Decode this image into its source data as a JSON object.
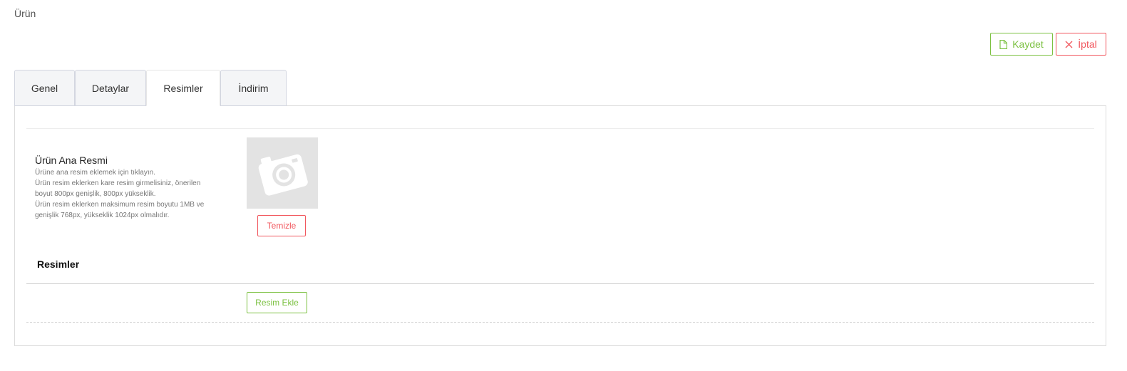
{
  "page": {
    "title": "Ürün"
  },
  "toolbar": {
    "save_label": "Kaydet",
    "cancel_label": "İptal",
    "save_icon": "file-icon",
    "cancel_icon": "close-icon",
    "save_color": "#7cc142",
    "cancel_color": "#f1565d"
  },
  "tabs": [
    {
      "label": "Genel"
    },
    {
      "label": "Detaylar"
    },
    {
      "label": "Resimler"
    },
    {
      "label": "İndirim"
    }
  ],
  "active_tab": "Resimler",
  "main_image": {
    "title": "Ürün Ana Resmi",
    "help_lines": [
      "Ürüne ana resim eklemek için tıklayın.",
      "Ürün resim eklerken kare resim girmelisiniz, önerilen",
      "boyut 800px genişlik, 800px yükseklik.",
      "Ürün resim eklerken maksimum resim boyutu 1MB ve",
      "genişlik 768px, yükseklik 1024px olmalıdır."
    ],
    "placeholder_icon": "camera-icon",
    "clear_label": "Temizle"
  },
  "images": {
    "title": "Resimler",
    "add_label": "Resim Ekle"
  }
}
